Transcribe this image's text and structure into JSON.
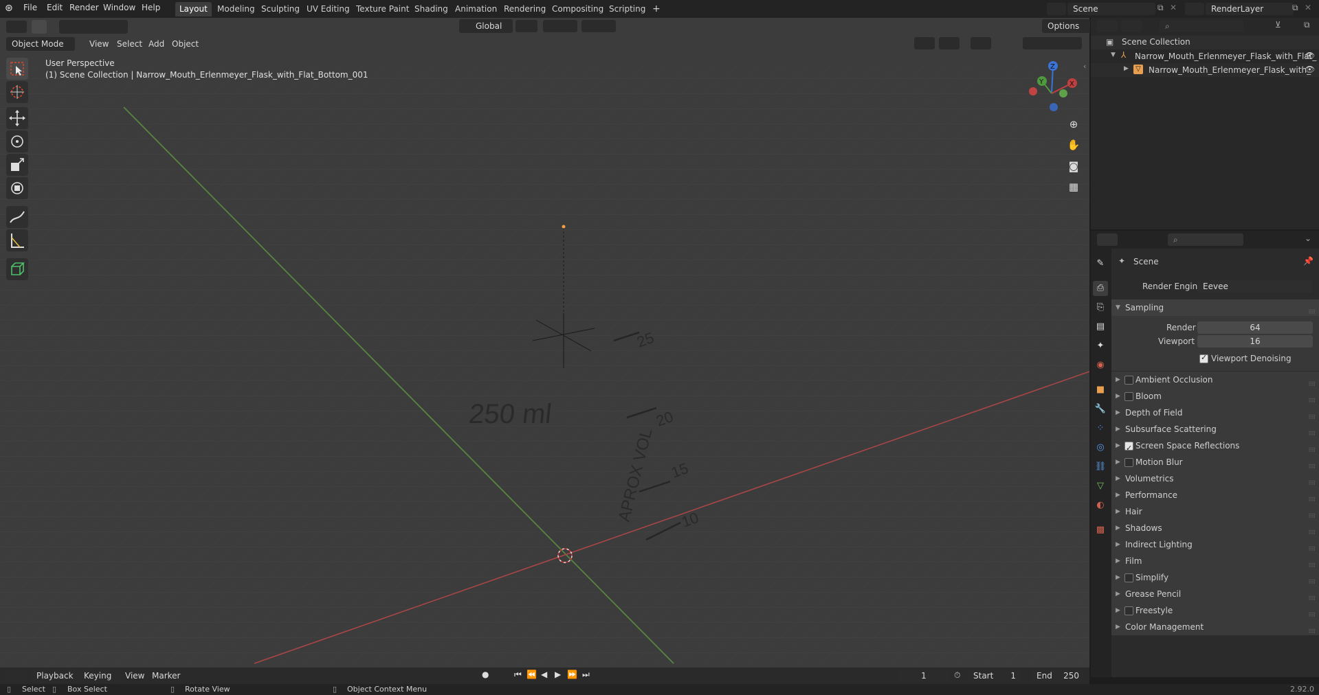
{
  "topbar": {
    "menus": [
      "File",
      "Edit",
      "Render",
      "Window",
      "Help"
    ],
    "workspaces": [
      "Layout",
      "Modeling",
      "Sculpting",
      "UV Editing",
      "Texture Paint",
      "Shading",
      "Animation",
      "Rendering",
      "Compositing",
      "Scripting"
    ],
    "active_workspace": "Layout",
    "add_tab": "+",
    "scene_name": "Scene",
    "view_layer": "RenderLayer"
  },
  "viewport_header": {
    "mode": "Object Mode",
    "menus": [
      "View",
      "Select",
      "Add",
      "Object"
    ],
    "transform_orientation": "Global",
    "options": "Options"
  },
  "viewport": {
    "perspective_label": "User Perspective",
    "collection_label": "(1) Scene Collection | Narrow_Mouth_Erlenmeyer_Flask_with_Flat_Bottom_001",
    "embossed_texts": [
      "250 ml",
      "APROX VOL",
      "25",
      "20",
      "15",
      "10"
    ],
    "gizmo_axes": [
      "Z",
      "Y",
      "X"
    ]
  },
  "outliner": {
    "root": "Scene Collection",
    "items": [
      {
        "label": "Narrow_Mouth_Erlenmeyer_Flask_with_Flat_",
        "type": "empty"
      },
      {
        "label": "Narrow_Mouth_Erlenmeyer_Flask_with_",
        "type": "mesh"
      }
    ]
  },
  "properties": {
    "context": "Scene",
    "render_engine_label": "Render Engine",
    "render_engine": "Eevee",
    "sampling": {
      "title": "Sampling",
      "render_label": "Render",
      "render_value": "64",
      "viewport_label": "Viewport",
      "viewport_value": "16",
      "denoise_label": "Viewport Denoising",
      "denoise_checked": true
    },
    "panels": [
      {
        "label": "Ambient Occlusion",
        "checkbox": true,
        "checked": false
      },
      {
        "label": "Bloom",
        "checkbox": true,
        "checked": false
      },
      {
        "label": "Depth of Field",
        "checkbox": false
      },
      {
        "label": "Subsurface Scattering",
        "checkbox": false
      },
      {
        "label": "Screen Space Reflections",
        "checkbox": true,
        "checked": true
      },
      {
        "label": "Motion Blur",
        "checkbox": true,
        "checked": false
      },
      {
        "label": "Volumetrics",
        "checkbox": false
      },
      {
        "label": "Performance",
        "checkbox": false
      },
      {
        "label": "Hair",
        "checkbox": false
      },
      {
        "label": "Shadows",
        "checkbox": false
      },
      {
        "label": "Indirect Lighting",
        "checkbox": false
      },
      {
        "label": "Film",
        "checkbox": false
      },
      {
        "label": "Simplify",
        "checkbox": true,
        "checked": false
      },
      {
        "label": "Grease Pencil",
        "checkbox": false
      },
      {
        "label": "Freestyle",
        "checkbox": true,
        "checked": false
      },
      {
        "label": "Color Management",
        "checkbox": false
      }
    ]
  },
  "timeline": {
    "menus": [
      "Playback",
      "Keying",
      "View",
      "Marker"
    ],
    "current_frame": "1",
    "start_label": "Start",
    "start": "1",
    "end_label": "End",
    "end": "250"
  },
  "statusbar": {
    "select": "Select",
    "box_select": "Box Select",
    "rotate_view": "Rotate View",
    "context_menu": "Object Context Menu",
    "version": "2.92.0"
  },
  "colors": {
    "accent": "#e0462a",
    "x_axis": "#b04a4a",
    "y_axis": "#4f8a3f",
    "z_blue": "#3b74d4"
  }
}
